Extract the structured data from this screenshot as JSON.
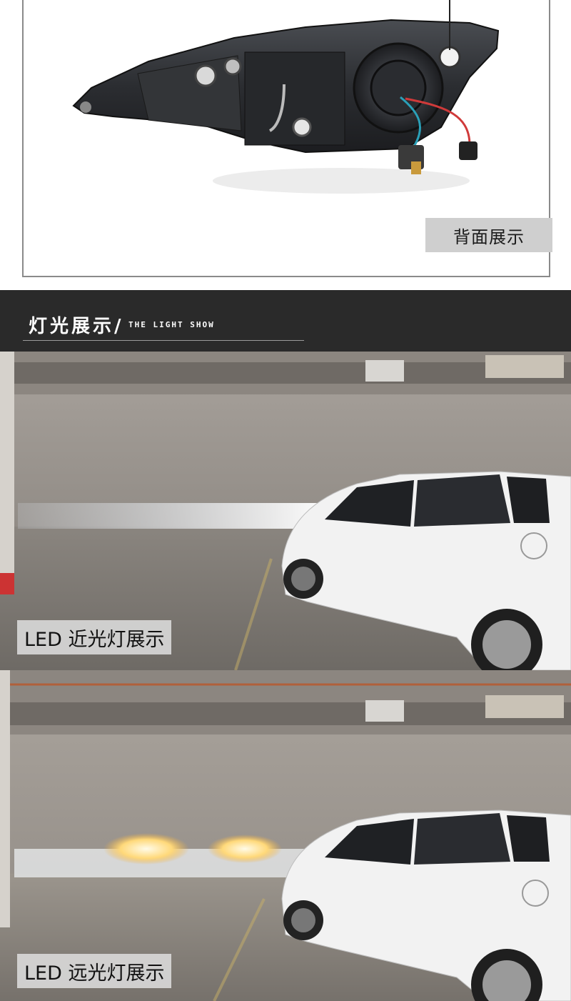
{
  "back_view": {
    "caption": "背面展示"
  },
  "section": {
    "title": "灯光展示",
    "slash": "/",
    "subtitle": "THE LIGHT SHOW"
  },
  "photos": [
    {
      "label": "LED 近光灯展示"
    },
    {
      "label": "LED 远光灯展示"
    }
  ]
}
